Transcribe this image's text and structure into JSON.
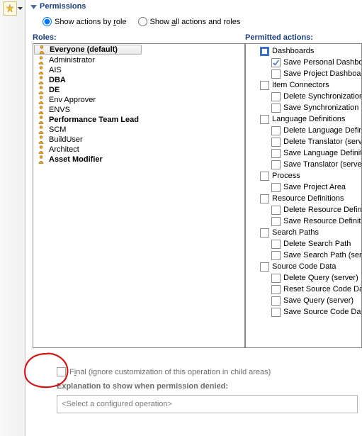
{
  "section": {
    "title": "Permissions"
  },
  "viewMode": {
    "byRole": "Show actions by role",
    "byRole_ul": "r",
    "all": "Show all actions and roles",
    "all_ul": "a"
  },
  "rolesLabel": "Roles:",
  "actionsLabel": "Permitted actions:",
  "roles": [
    {
      "name": "Everyone (default)",
      "bold": true,
      "selected": true
    },
    {
      "name": "Administrator",
      "bold": false
    },
    {
      "name": "AIS",
      "bold": false
    },
    {
      "name": "DBA",
      "bold": true
    },
    {
      "name": "DE",
      "bold": true
    },
    {
      "name": "Env Approver",
      "bold": false
    },
    {
      "name": "ENVS",
      "bold": false
    },
    {
      "name": "Performance Team Lead",
      "bold": true
    },
    {
      "name": "SCM",
      "bold": false
    },
    {
      "name": "BuildUser",
      "bold": false
    },
    {
      "name": "Architect",
      "bold": false
    },
    {
      "name": "Asset Modifier",
      "bold": true
    }
  ],
  "actionsTree": [
    {
      "label": "Dashboards",
      "state": "mixed",
      "children": [
        {
          "label": "Save Personal Dashboard",
          "state": "checked"
        },
        {
          "label": "Save Project Dashboard",
          "state": ""
        }
      ]
    },
    {
      "label": "Item Connectors",
      "state": "",
      "children": [
        {
          "label": "Delete Synchronization Rule",
          "state": ""
        },
        {
          "label": "Save Synchronization Rule",
          "state": ""
        }
      ]
    },
    {
      "label": "Language Definitions",
      "state": "",
      "children": [
        {
          "label": "Delete Language Definition",
          "state": ""
        },
        {
          "label": "Delete Translator (server)",
          "state": ""
        },
        {
          "label": "Save Language Definition",
          "state": ""
        },
        {
          "label": "Save Translator (server)",
          "state": ""
        }
      ]
    },
    {
      "label": "Process",
      "state": "",
      "children": [
        {
          "label": "Save Project Area",
          "state": ""
        }
      ]
    },
    {
      "label": "Resource Definitions",
      "state": "",
      "children": [
        {
          "label": "Delete Resource Definition",
          "state": ""
        },
        {
          "label": "Save Resource Definition",
          "state": ""
        }
      ]
    },
    {
      "label": "Search Paths",
      "state": "",
      "children": [
        {
          "label": "Delete Search Path",
          "state": ""
        },
        {
          "label": "Save Search Path (server)",
          "state": ""
        }
      ]
    },
    {
      "label": "Source Code Data",
      "state": "",
      "children": [
        {
          "label": "Delete Query (server)",
          "state": ""
        },
        {
          "label": "Reset Source Code Data",
          "state": ""
        },
        {
          "label": "Save Query (server)",
          "state": ""
        },
        {
          "label": "Save Source Code Data",
          "state": ""
        }
      ]
    }
  ],
  "final": {
    "label_pre": "F",
    "label_ul": "i",
    "label_post": "nal (ignore customization of this operation in child areas)"
  },
  "explanationLabel": "Explanation to show when permission denied:",
  "selectPlaceholder": "<Select a configured operation>"
}
